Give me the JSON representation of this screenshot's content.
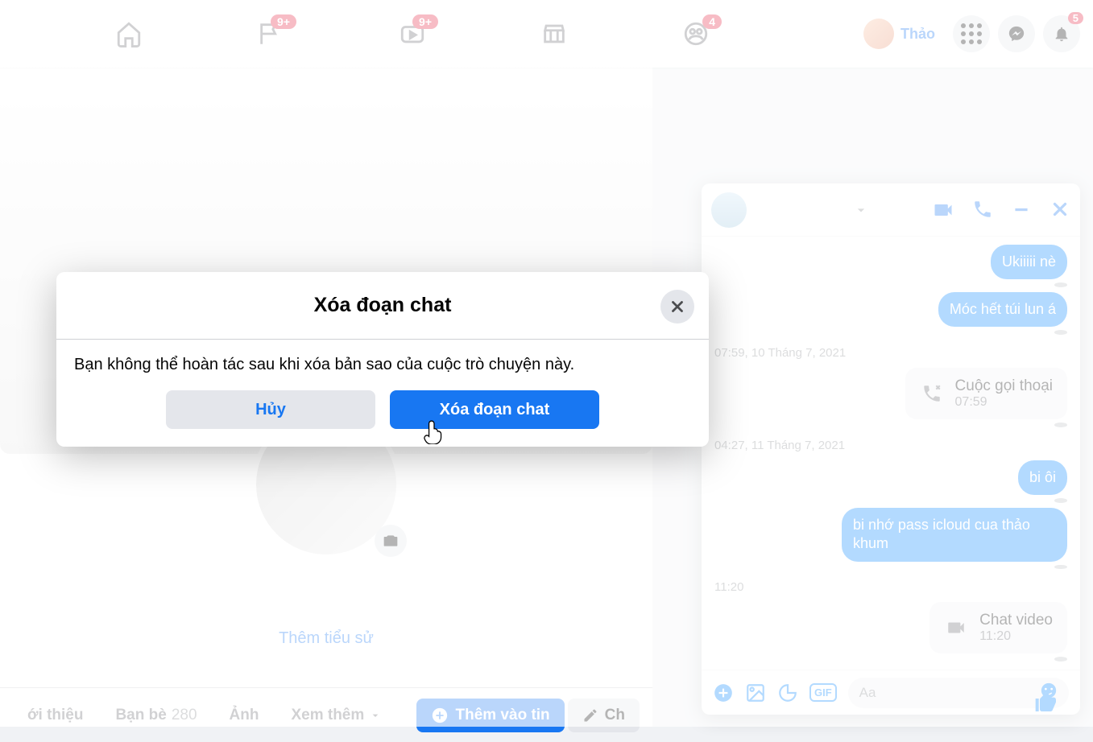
{
  "topnav": {
    "home_badge": "",
    "pages_badge": "9+",
    "watch_badge": "9+",
    "market_badge": "",
    "groups_badge": "4",
    "user_name": "Thảo",
    "notif_badge": "5"
  },
  "profile": {
    "bio_link": "Thêm tiểu sử",
    "tabs": {
      "intro": "ới thiệu",
      "friends": "Bạn bè",
      "friends_count": "280",
      "photos": "Ảnh",
      "more": "Xem thêm"
    },
    "btn_add_story": "Thêm vào tin",
    "btn_edit": "Ch"
  },
  "chat": {
    "messages": [
      {
        "type": "out",
        "text": "Ukiiiii nè"
      },
      {
        "type": "out",
        "text": "Móc hết túi lun á"
      },
      {
        "type": "ts",
        "text": "07:59, 10 Tháng 7, 2021",
        "align": "left"
      },
      {
        "type": "call",
        "title": "Cuộc gọi thoại",
        "time": "07:59",
        "icon": "phone-missed"
      },
      {
        "type": "ts",
        "text": "04:27, 11 Tháng 7, 2021",
        "align": "left"
      },
      {
        "type": "out",
        "text": "bi ôi"
      },
      {
        "type": "out",
        "text": "bi nhớ pass icloud cua thảo khum"
      },
      {
        "type": "ts",
        "text": "11:20",
        "align": "left"
      },
      {
        "type": "call",
        "title": "Chat video",
        "time": "11:20",
        "icon": "video"
      }
    ],
    "input_placeholder": "Aa",
    "gif_label": "GIF"
  },
  "modal": {
    "title": "Xóa đoạn chat",
    "body": "Bạn không thể hoàn tác sau khi xóa bản sao của cuộc trò chuyện này.",
    "cancel": "Hủy",
    "confirm": "Xóa đoạn chat"
  }
}
